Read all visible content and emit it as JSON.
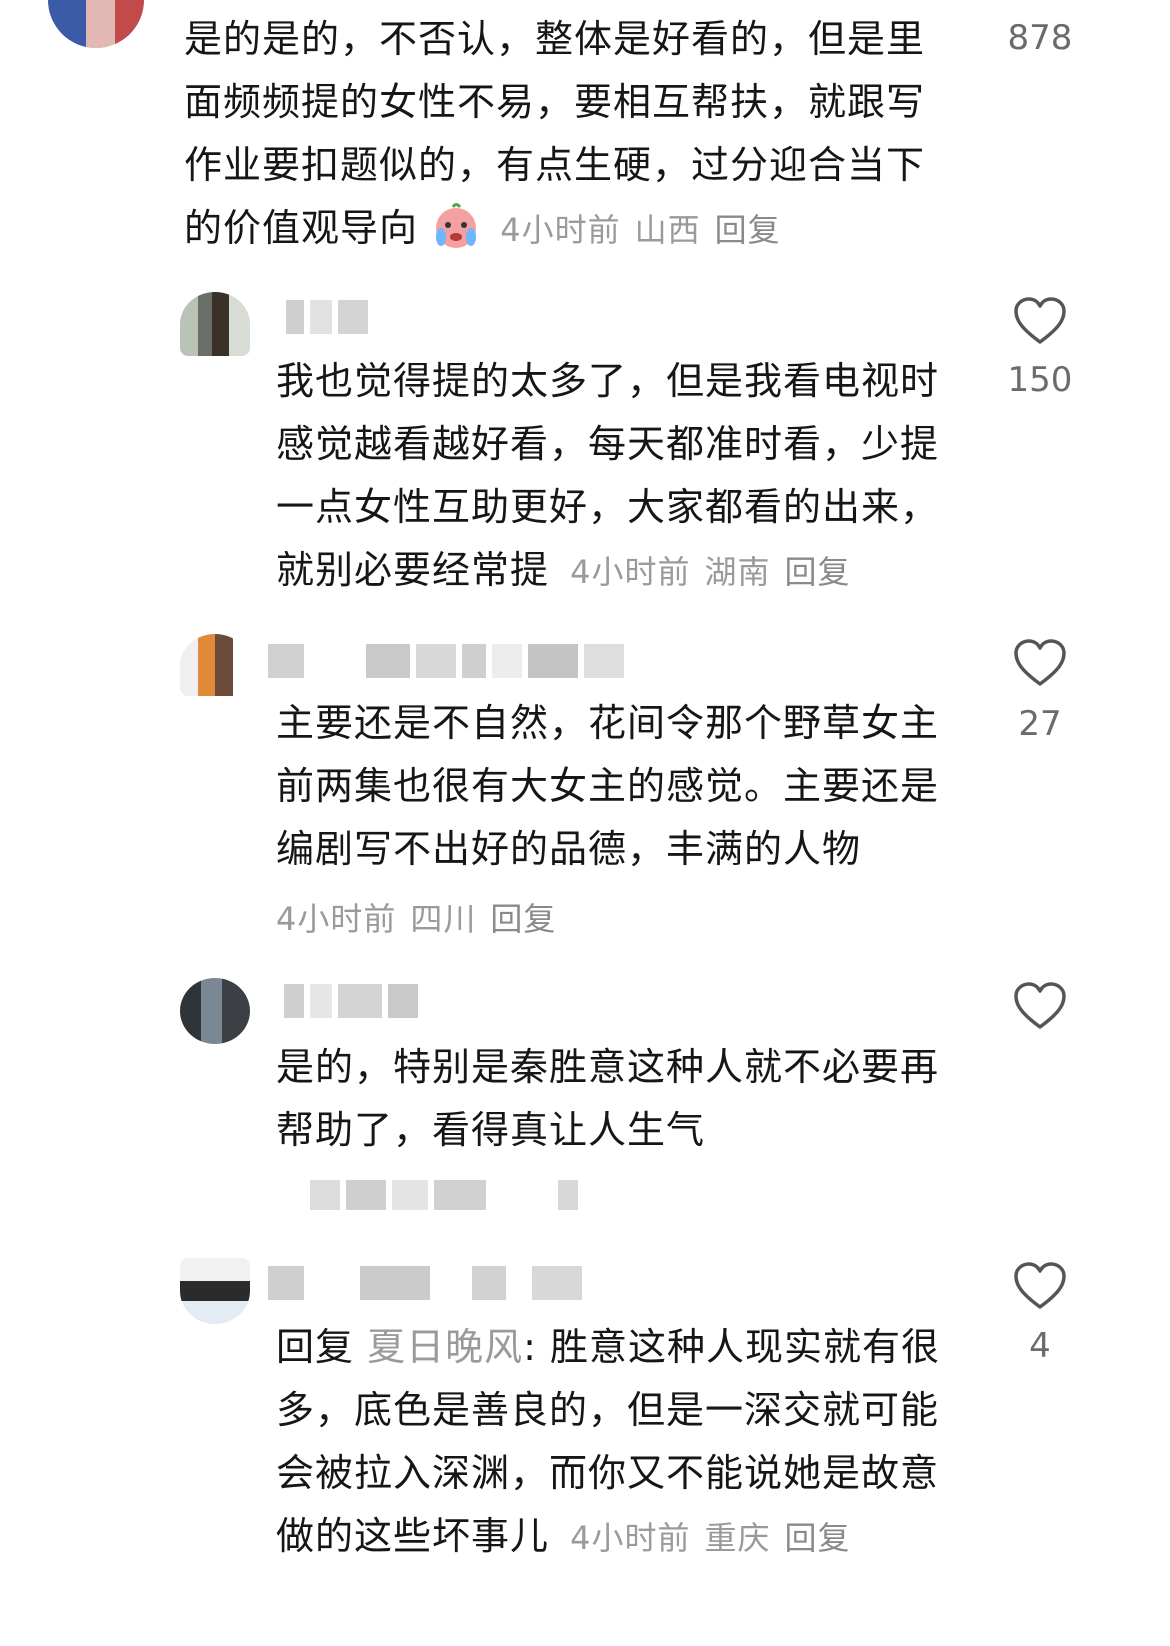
{
  "comments": [
    {
      "id": "c1",
      "text": "是的是的，不否认，整体是好看的，但是里面频频提的女性不易，要相互帮扶，就跟写作业要扣题似的，有点生硬，过分迎合当下的价值观导向",
      "lines": [
        "是的是的，不否认，整体是好看的，但是里",
        "面频频提的女性不易，要相互帮扶，就跟写",
        "作业要扣题似的，有点生硬，过分迎合当下",
        "的价值观导向"
      ],
      "time": "4小时前",
      "location": "山西",
      "reply": "回复",
      "likes": "878"
    },
    {
      "id": "c2",
      "lines": [
        "我也觉得提的太多了，但是我看电视时",
        "感觉越看越好看，每天都准时看，少提",
        "一点女性互助更好，大家都看的出来，",
        "就别必要经常提"
      ],
      "time": "4小时前",
      "location": "湖南",
      "reply": "回复",
      "likes": "150"
    },
    {
      "id": "c3",
      "lines": [
        "主要还是不自然，花间令那个野草女主",
        "前两集也很有大女主的感觉。主要还是",
        "编剧写不出好的品德，丰满的人物"
      ],
      "time": "4小时前",
      "location": "四川",
      "reply": "回复",
      "likes": "27"
    },
    {
      "id": "c4",
      "lines": [
        "是的，特别是秦胜意这种人就不必要再",
        "帮助了，看得真让人生气"
      ],
      "likes": ""
    },
    {
      "id": "c5",
      "reply_prefix": "回复",
      "reply_to": "夏日晚风",
      "lines_first_rest": ": 胜意这种人现实就有很",
      "lines": [
        "多，底色是善良的，但是一深交就可能",
        "会被拉入深渊，而你又不能说她是故意",
        "做的这些坏事儿"
      ],
      "time": "4小时前",
      "location": "重庆",
      "reply": "回复",
      "likes": "4"
    }
  ],
  "icons": {
    "like": "heart-outline-icon",
    "emoji": "crying-face-emoji"
  },
  "colors": {
    "text": "#161616",
    "meta": "#9a9a9a",
    "count": "#6b6b6b"
  }
}
